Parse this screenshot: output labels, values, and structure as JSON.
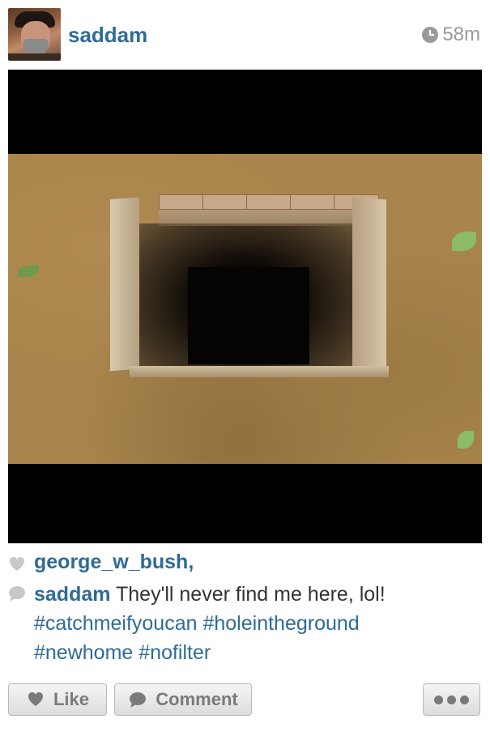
{
  "post": {
    "username": "saddam",
    "time_ago": "58m",
    "likes": {
      "liker": "george_w_bush,"
    },
    "caption": {
      "user": "saddam",
      "text": "They'll never find me here, lol!",
      "hashtags": [
        "#catchmeifyoucan",
        "#holeintheground",
        "#newhome",
        "#nofilter"
      ]
    }
  },
  "actions": {
    "like_label": "Like",
    "comment_label": "Comment"
  },
  "icons": {
    "time": "clock-icon",
    "likes": "heart-icon",
    "caption": "comment-bubble-icon",
    "more": "more-dots-icon"
  },
  "colors": {
    "username": "#2f6b96",
    "hashtag": "#2f6b96",
    "time": "#9a9a9a"
  }
}
